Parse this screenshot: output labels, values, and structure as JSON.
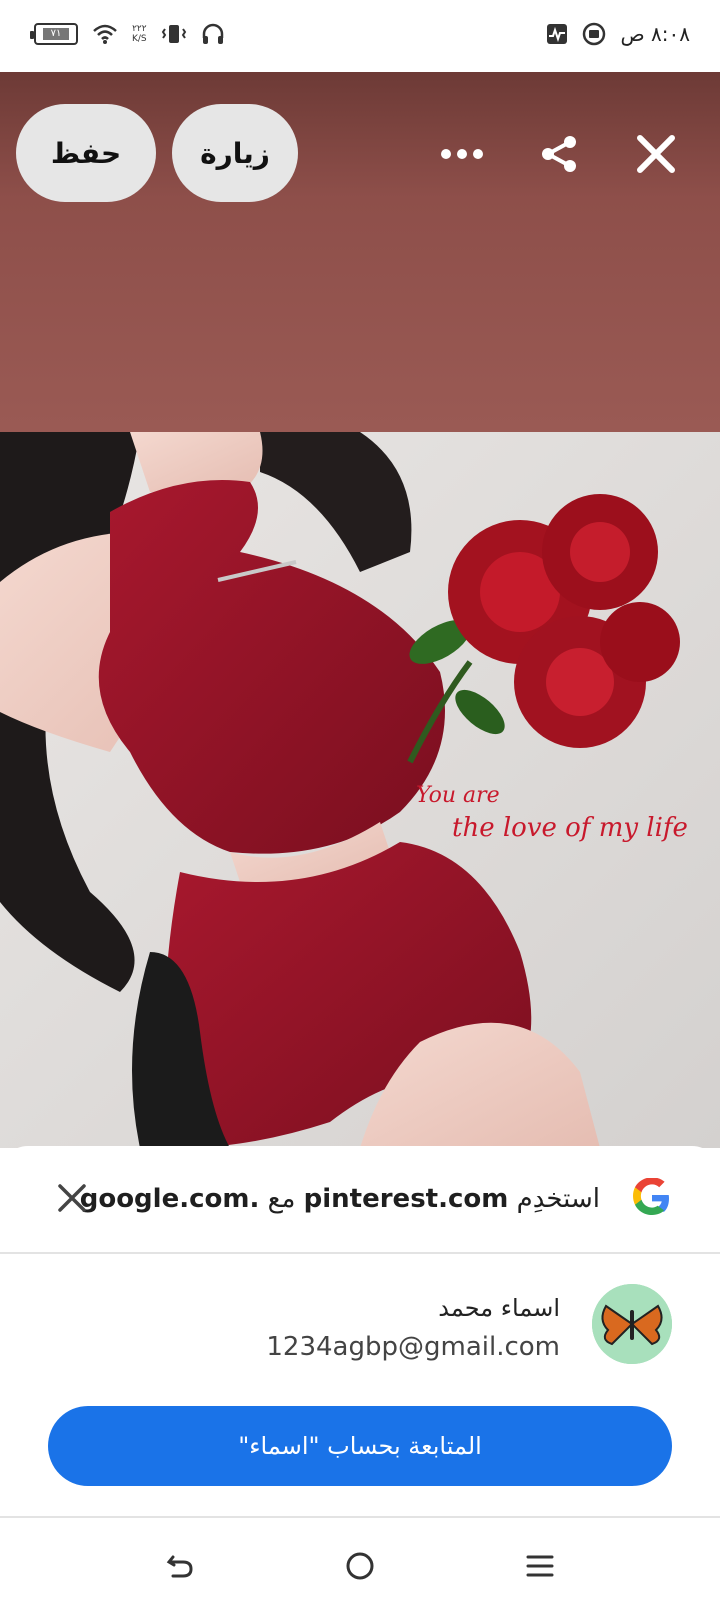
{
  "status_bar": {
    "time": "٨:٠٨ ص",
    "battery": "٧١",
    "net_speed_value": "٢٢٢",
    "net_speed_unit": "K/S",
    "icons": [
      "battery-icon",
      "wifi-icon",
      "vibrate-icon",
      "headphones-icon",
      "activity-icon",
      "record-icon"
    ]
  },
  "toolbar": {
    "save_label": "حفظ",
    "visit_label": "زيارة",
    "icons": [
      "more-icon",
      "share-icon",
      "close-icon"
    ]
  },
  "image_text": {
    "line1": "You are",
    "line2": "the love of my life"
  },
  "google_sheet": {
    "title_prefix": "استخدِم",
    "title_site": "pinterest.com",
    "title_mid": "مع",
    "title_google": "google.com.",
    "account_name": "اسماء محمد",
    "account_email": "1234agbp@gmail.com",
    "continue_label": "المتابعة بحساب \"اسماء\""
  },
  "nav": {
    "icons": [
      "back-icon",
      "home-icon",
      "recents-icon"
    ]
  },
  "colors": {
    "primary_button": "#1a73e8",
    "banner": "#9a5a54",
    "pill": "#e6e6e6"
  }
}
